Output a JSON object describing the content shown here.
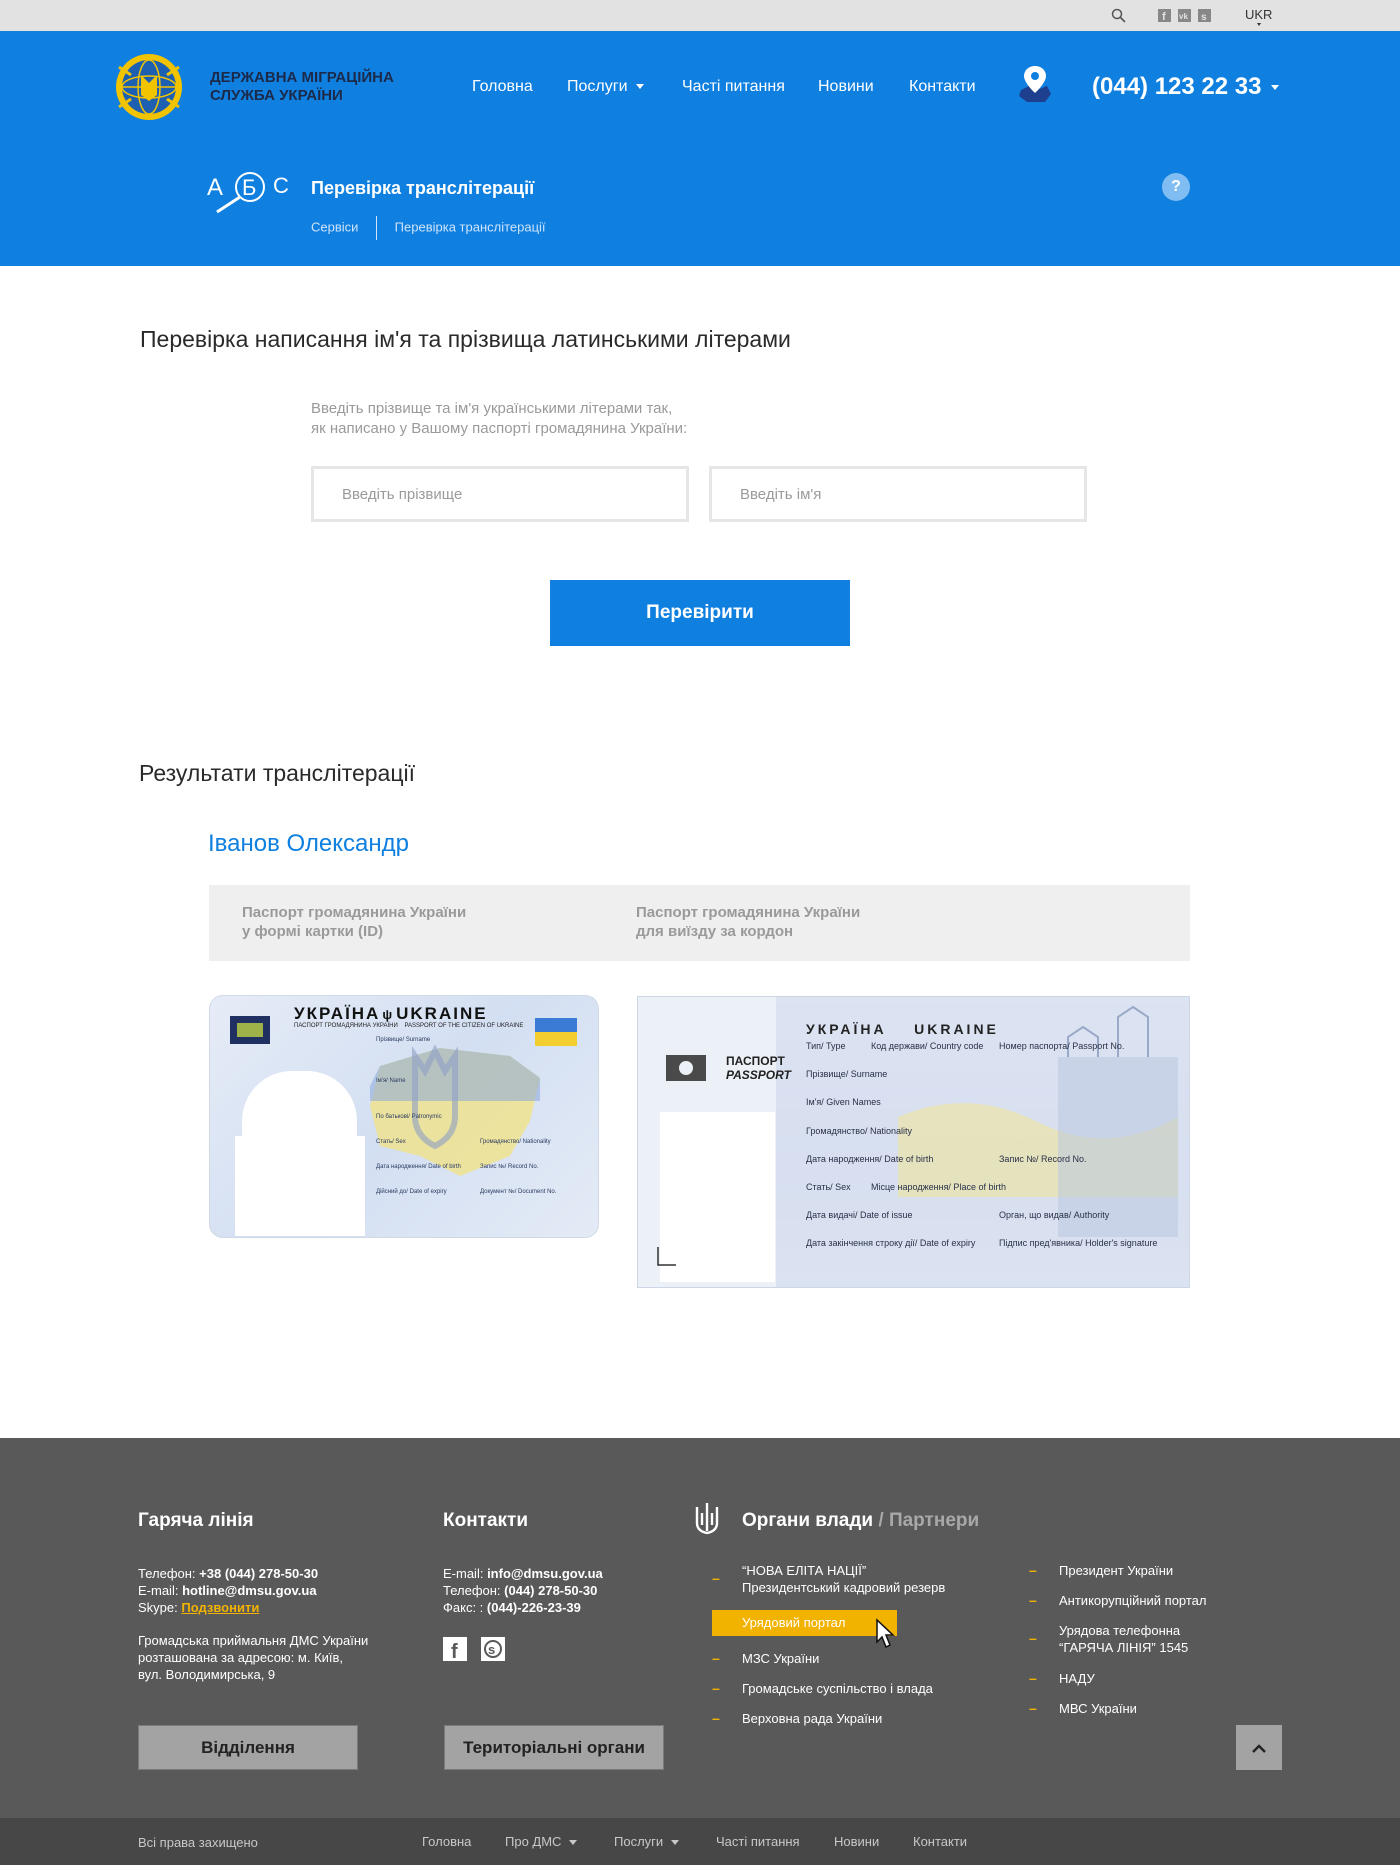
{
  "topbar": {
    "language": "UKR"
  },
  "header": {
    "org_line1": "ДЕРЖАВНА МІГРАЦІЙНА",
    "org_line2": "СЛУЖБА УКРАЇНИ",
    "nav": [
      {
        "label": "Головна"
      },
      {
        "label": "Послуги"
      },
      {
        "label": "Часті питання"
      },
      {
        "label": "Новини"
      },
      {
        "label": "Контакти"
      }
    ],
    "phone": "(044) 123 22 33",
    "page_title": "Перевірка транслітерації",
    "breadcrumb": [
      "Сервіси",
      "Перевірка транслітерації"
    ],
    "service_letters": "А Б С",
    "help": "?"
  },
  "form": {
    "heading": "Перевірка написання ім'я та прізвища латинськими літерами",
    "instructions_line1": "Введіть прізвище та ім'я українськими літерами так,",
    "instructions_line2": "як написано у Вашому паспорті громадянина України:",
    "surname_placeholder": "Введіть прізвище",
    "name_placeholder": "Введіть ім'я",
    "submit": "Перевірити"
  },
  "results": {
    "heading": "Результати транслітерації",
    "name": "Іванов Олександр",
    "col1_line1": "Паспорт громадянина України",
    "col1_line2": "у формі картки (ID)",
    "col2_line1": "Паспорт громадянина України",
    "col2_line2": "для виїзду за кордон",
    "id_card": {
      "title_ua": "УКРАЇНА",
      "title_en": "UKRAINE",
      "subtitle": "ПАСПОРТ ГРОМАДЯНИНА УКРАЇНИ    PASSPORT OF THE CITIZEN OF UKRAINE",
      "fields": [
        "Прізвище/ Surname",
        "Ім'я/ Name",
        "По батькові/ Patronymic",
        "Стать/ Sex",
        "Громадянство/ Nationality",
        "Дата народження/ Date of birth",
        "Запис №/ Record No.",
        "Дійсний до/ Date of expiry",
        "Документ №/ Document No."
      ]
    },
    "passport": {
      "title": "УКРАЇНА    UKRAINE",
      "label_ua": "ПАСПОРТ",
      "label_en": "PASSPORT",
      "fields": [
        "Тип/ Type",
        "Код держави/ Country code",
        "Номер паспорта/ Passport No.",
        "Прізвище/ Surname",
        "Ім'я/ Given Names",
        "Громадянство/ Nationality",
        "Дата народження/ Date of birth",
        "Запис №/ Record No.",
        "Стать/ Sex",
        "Місце народження/ Place of birth",
        "Дата видачі/ Date of issue",
        "Орган, що видав/ Authority",
        "Дата закінчення строку дії/ Date of expiry",
        "Підпис пред'явника/ Holder's signature"
      ]
    }
  },
  "footer": {
    "hotline": {
      "title": "Гаряча лінія",
      "phone_label": "Телефон: ",
      "phone": "+38 (044) 278-50-30",
      "email_label": "E-mail: ",
      "email": "hotline@dmsu.gov.ua",
      "skype_label": "Skype: ",
      "skype": "Подзвонити",
      "address_line1": "Громадська приймальня ДМС України",
      "address_line2": "розташована за адресою: м. Київ,",
      "address_line3": "вул. Володимирська, 9",
      "button": "Відділення"
    },
    "contacts": {
      "title": "Контакти",
      "email_label": "E-mail: ",
      "email": "info@dmsu.gov.ua",
      "phone_label": "Телефон: ",
      "phone": "(044) 278-50-30",
      "fax_label": "Факс: : ",
      "fax": "(044)-226-23-39",
      "button": "Територіальні органи"
    },
    "partners": {
      "title_main": "Органи влади",
      "title_sep": " / ",
      "title_sub": "Партнери",
      "col1": [
        {
          "label": "“НОВА ЕЛІТА НАЦІЇ”",
          "label2": "Президентський кадровий резерв"
        },
        {
          "label": "Урядовий портал",
          "highlight": true
        },
        {
          "label": "МЗС України"
        },
        {
          "label": "Громадське суспільство і влада"
        },
        {
          "label": "Верховна рада України"
        }
      ],
      "col2": [
        {
          "label": "Президент України"
        },
        {
          "label": "Антикорупційний портал"
        },
        {
          "label": "Урядова телефонна",
          "label2": "“ГАРЯЧА ЛІНІЯ” 1545"
        },
        {
          "label": "НАДУ"
        },
        {
          "label": "МВС України"
        }
      ]
    }
  },
  "bottombar": {
    "copyright": "Всі права захищено",
    "links": [
      "Головна",
      "Про ДМС",
      "Послуги",
      "Часті питання",
      "Новини",
      "Контакти"
    ]
  },
  "colors": {
    "brand_blue": "#0f7fe0",
    "accent_yellow": "#f2b200",
    "footer_gray": "#595959"
  }
}
